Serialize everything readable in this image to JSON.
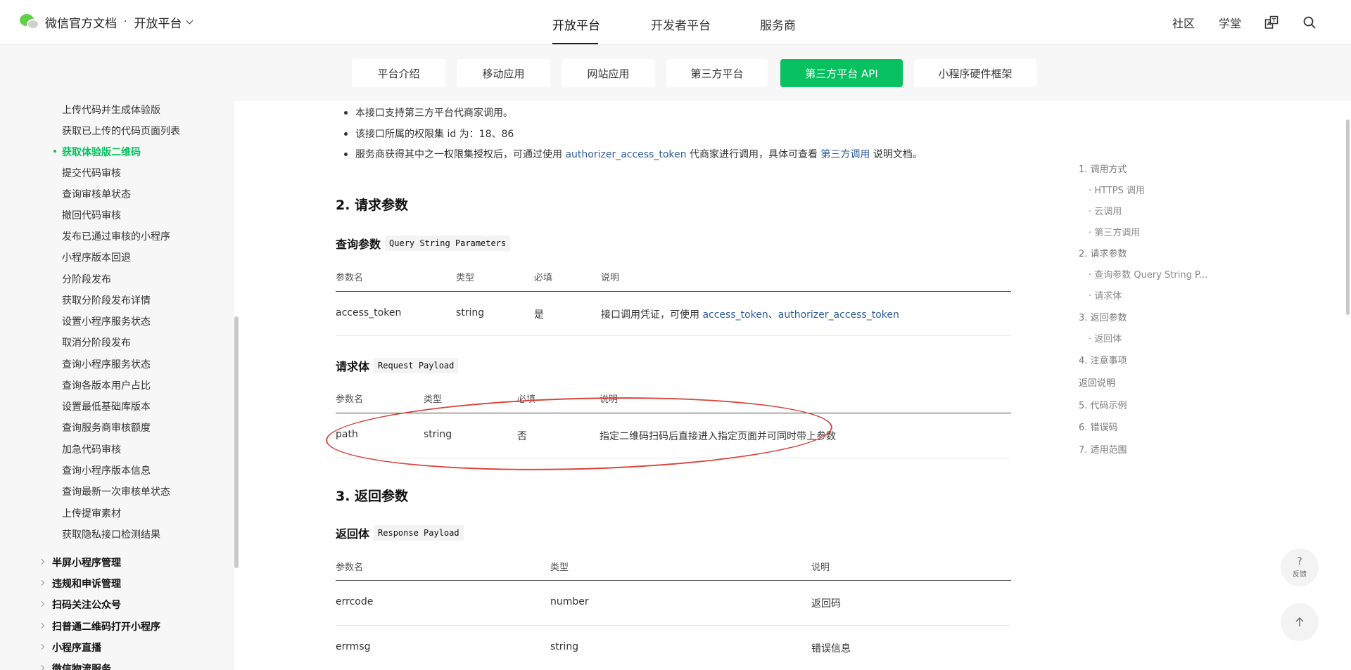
{
  "header": {
    "logo_title": "微信官方文档",
    "separator": "·",
    "platform_label": "开放平台",
    "nav": [
      "开放平台",
      "开发者平台",
      "服务商"
    ],
    "right_links": [
      "社区",
      "学堂"
    ]
  },
  "tabs": [
    "平台介绍",
    "移动应用",
    "网站应用",
    "第三方平台",
    "第三方平台 API",
    "小程序硬件框架"
  ],
  "sidebar": {
    "items": [
      "上传代码并生成体验版",
      "获取已上传的代码页面列表",
      "获取体验版二维码",
      "提交代码审核",
      "查询审核单状态",
      "撤回代码审核",
      "发布已通过审核的小程序",
      "小程序版本回退",
      "分阶段发布",
      "获取分阶段发布详情",
      "设置小程序服务状态",
      "取消分阶段发布",
      "查询小程序服务状态",
      "查询各版本用户占比",
      "设置最低基础库版本",
      "查询服务商审核额度",
      "加急代码审核",
      "查询小程序版本信息",
      "查询最新一次审核单状态",
      "上传提审素材",
      "获取隐私接口检测结果"
    ],
    "groups": [
      "半屏小程序管理",
      "违规和申诉管理",
      "扫码关注公众号",
      "扫普通二维码打开小程序",
      "小程序直播",
      "微信物流服务"
    ]
  },
  "content": {
    "bullets": {
      "b1": "本接口支持第三方平台代商家调用。",
      "b2": "该接口所属的权限集 id 为：18、86",
      "b3_pre": "服务商获得其中之一权限集授权后，可通过使用 ",
      "b3_link1": "authorizer_access_token",
      "b3_mid": " 代商家进行调用，具体可查看 ",
      "b3_link2": "第三方调用",
      "b3_post": " 说明文档。"
    },
    "section2_title": "2. 请求参数",
    "query": {
      "title": "查询参数",
      "code": "Query String Parameters",
      "headers": [
        "参数名",
        "类型",
        "必填",
        "说明"
      ],
      "row": {
        "name": "access_token",
        "type": "string",
        "required": "是",
        "desc_pre": "接口调用凭证，可使用 ",
        "link1": "access_token",
        "sep": "、",
        "link2": "authorizer_access_token"
      }
    },
    "payload": {
      "title": "请求体",
      "code": "Request Payload",
      "headers": [
        "参数名",
        "类型",
        "必填",
        "说明"
      ],
      "row": {
        "name": "path",
        "type": "string",
        "required": "否",
        "desc": "指定二维码扫码后直接进入指定页面并可同时带上参数"
      }
    },
    "section3_title": "3. 返回参数",
    "response": {
      "title": "返回体",
      "code": "Response Payload",
      "headers": [
        "参数名",
        "类型",
        "说明"
      ],
      "rows": [
        {
          "name": "errcode",
          "type": "number",
          "desc": "返回码"
        },
        {
          "name": "errmsg",
          "type": "string",
          "desc": "错误信息"
        }
      ]
    }
  },
  "toc": [
    "1. 调用方式",
    "· HTTPS 调用",
    "· 云调用",
    "· 第三方调用",
    "2. 请求参数",
    "· 查询参数 Query String P...",
    "· 请求体",
    "3. 返回参数",
    "· 返回体",
    "4. 注意事项",
    "返回说明",
    "5. 代码示例",
    "6. 错误码",
    "7. 适用范围"
  ],
  "feedback": {
    "icon": "?",
    "label": "反馈"
  },
  "colors": {
    "accent": "#07c160",
    "link": "#2d5d9a",
    "annotation": "#d9433b"
  }
}
